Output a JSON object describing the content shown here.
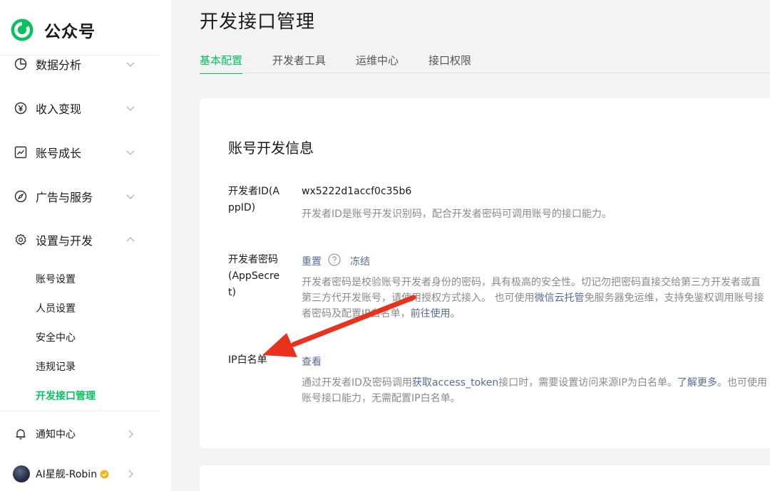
{
  "sidebar": {
    "brand_name": "公众号",
    "items": [
      {
        "label": "数据分析"
      },
      {
        "label": "收入变现"
      },
      {
        "label": "账号成长"
      },
      {
        "label": "广告与服务"
      },
      {
        "label": "设置与开发"
      }
    ],
    "sub_items": [
      {
        "label": "账号设置"
      },
      {
        "label": "人员设置"
      },
      {
        "label": "安全中心"
      },
      {
        "label": "违规记录"
      },
      {
        "label": "开发接口管理"
      }
    ],
    "notification_label": "通知中心",
    "account_name": "AI星舰-Robin"
  },
  "main": {
    "page_title": "开发接口管理",
    "tabs": [
      {
        "label": "基本配置"
      },
      {
        "label": "开发者工具"
      },
      {
        "label": "运维中心"
      },
      {
        "label": "接口权限"
      }
    ],
    "card": {
      "title": "账号开发信息",
      "appid": {
        "label": "开发者ID(AppID)",
        "value": "wx5222d1accf0c35b6",
        "desc": "开发者ID是账号开发识别码，配合开发者密码可调用账号的接口能力。"
      },
      "secret": {
        "label": "开发者密码(AppSecret)",
        "reset": "重置",
        "freeze": "冻结",
        "desc_line1": "开发者密码是校验账号开发者身份的密码，具有极高的安全性。切记勿把密码直接交给第三方开发者或直",
        "desc_line2_a": "第三方代开发账号，请使用授权方式接入。 也可使用",
        "desc_line2_link": "微信云托管",
        "desc_line2_b": "免服务器免运维，支持免鉴权调用账号接",
        "desc_line3_a": "者密码及配置IP白名单，",
        "desc_line3_link": "前往使用",
        "desc_line3_b": "。"
      },
      "ip": {
        "label": "IP白名单",
        "view": "查看",
        "desc_line1_a": "通过开发者ID及密码调用",
        "desc_line1_link1": "获取access_token",
        "desc_line1_b": "接口时，需要设置访问来源IP为白名单。",
        "desc_line1_link2": "了解更多",
        "desc_line1_c": "。也可使用",
        "desc_line2": "账号接口能力，无需配置IP白名单。"
      }
    }
  },
  "colors": {
    "accent": "#07c160",
    "link": "#576b95",
    "annotation": "#e8321c"
  }
}
